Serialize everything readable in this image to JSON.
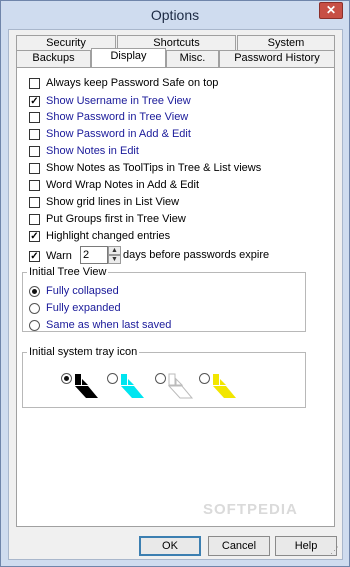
{
  "window": {
    "title": "Options",
    "close_label": "✕"
  },
  "tabs": {
    "row1": [
      {
        "label": "Security"
      },
      {
        "label": "Shortcuts"
      },
      {
        "label": "System"
      }
    ],
    "row2": [
      {
        "label": "Backups"
      },
      {
        "label": "Display",
        "active": true
      },
      {
        "label": "Misc."
      },
      {
        "label": "Password History"
      }
    ]
  },
  "display": {
    "options": [
      {
        "label": "Always keep Password Safe on top",
        "checked": false,
        "blue": false
      },
      {
        "label": "Show Username in Tree View",
        "checked": true,
        "blue": true
      },
      {
        "label": "Show Password in Tree View",
        "checked": false,
        "blue": true
      },
      {
        "label": "Show Password in Add & Edit",
        "checked": false,
        "blue": true
      },
      {
        "label": "Show Notes in Edit",
        "checked": false,
        "blue": true
      },
      {
        "label": "Show Notes as ToolTips in Tree & List views",
        "checked": false,
        "blue": false
      },
      {
        "label": "Word Wrap Notes in Add & Edit",
        "checked": false,
        "blue": false
      },
      {
        "label": "Show grid lines in List View",
        "checked": false,
        "blue": false
      },
      {
        "label": "Put Groups first in Tree View",
        "checked": false,
        "blue": false
      },
      {
        "label": "Highlight changed entries",
        "checked": true,
        "blue": false
      }
    ],
    "warn": {
      "label": "Warn",
      "checked": true,
      "days_value": "2",
      "suffix": "days before passwords expire"
    },
    "tree_view": {
      "title": "Initial Tree View",
      "options": [
        {
          "label": "Fully collapsed",
          "selected": true
        },
        {
          "label": "Fully expanded",
          "selected": false
        },
        {
          "label": "Same as when last saved",
          "selected": false
        }
      ]
    },
    "tray_icon": {
      "title": "Initial system tray icon",
      "options": [
        {
          "name": "black",
          "color": "#000000",
          "selected": true
        },
        {
          "name": "cyan",
          "color": "#00e5f0",
          "selected": false
        },
        {
          "name": "white",
          "color": "#ffffff",
          "selected": false
        },
        {
          "name": "yellow",
          "color": "#f2e600",
          "selected": false
        }
      ]
    }
  },
  "buttons": {
    "ok": "OK",
    "cancel": "Cancel",
    "help": "Help"
  },
  "watermark": "SOFTPEDIA"
}
